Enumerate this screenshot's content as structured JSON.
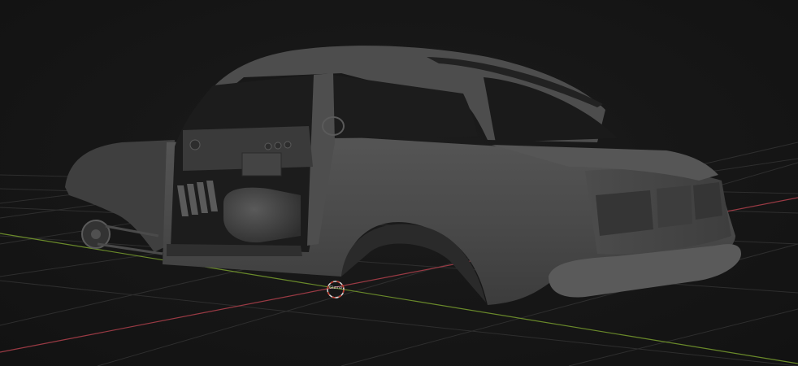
{
  "viewport": {
    "origin_label": "Gizmo",
    "colors": {
      "background": "#131313",
      "grid": "#2e2e2e",
      "x_axis": "#9a3a44",
      "y_axis": "#6a8a2a",
      "body": "#4a4a4a",
      "gizmo_ring": "#d8d8d8",
      "gizmo_dash": "#c0392b"
    }
  }
}
